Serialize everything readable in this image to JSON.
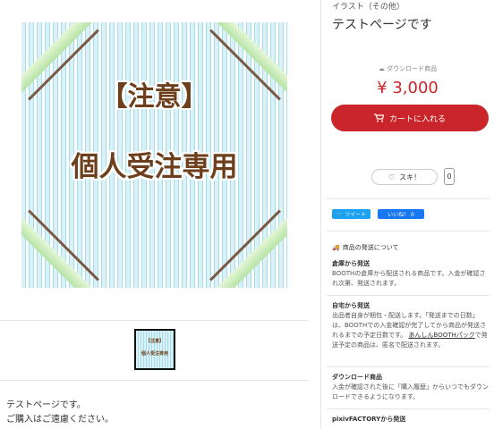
{
  "product": {
    "category": "イラスト（その他）",
    "title": "テストページです",
    "download_label": "ダウンロード商品",
    "price": "¥ 3,000",
    "cart_label": "カートに入れる",
    "like_label": "スキ！",
    "like_count": "0"
  },
  "image": {
    "line1": "【注意】",
    "line2": "個人受注専用",
    "thumb_line1": "【注意】",
    "thumb_line2": "個人受注専用"
  },
  "description": {
    "line1": "テストページです。",
    "line2": "ご購入はご遠慮ください。"
  },
  "social": {
    "tweet": "ツイート",
    "fb_like": "いいね！ 0"
  },
  "shipping": {
    "heading": "商品の発送について",
    "items": [
      {
        "title": "倉庫から発送",
        "text": "BOOTHの倉庫から配送される商品です。入金が確認され次第、発送されます。"
      },
      {
        "title": "自宅から発送",
        "text": "出品者自身が梱包・配送します。「発送までの日数」は、BOOTHでの入金確認が完了してから商品が発送されるまでの予定日数です。",
        "link": "あんしんBOOTHパック",
        "link_suffix": "で発送予定の商品は、匿名で配送されます。"
      },
      {
        "title": "ダウンロード商品",
        "text": "入金が確認された後に「購入履歴」からいつでもダウンロードできるようになります。"
      },
      {
        "title": "pixivFACTORYから発送",
        "text": ""
      }
    ]
  },
  "colors": {
    "accent": "#c9252b",
    "twitter": "#1da1f2",
    "facebook": "#1877f2"
  }
}
